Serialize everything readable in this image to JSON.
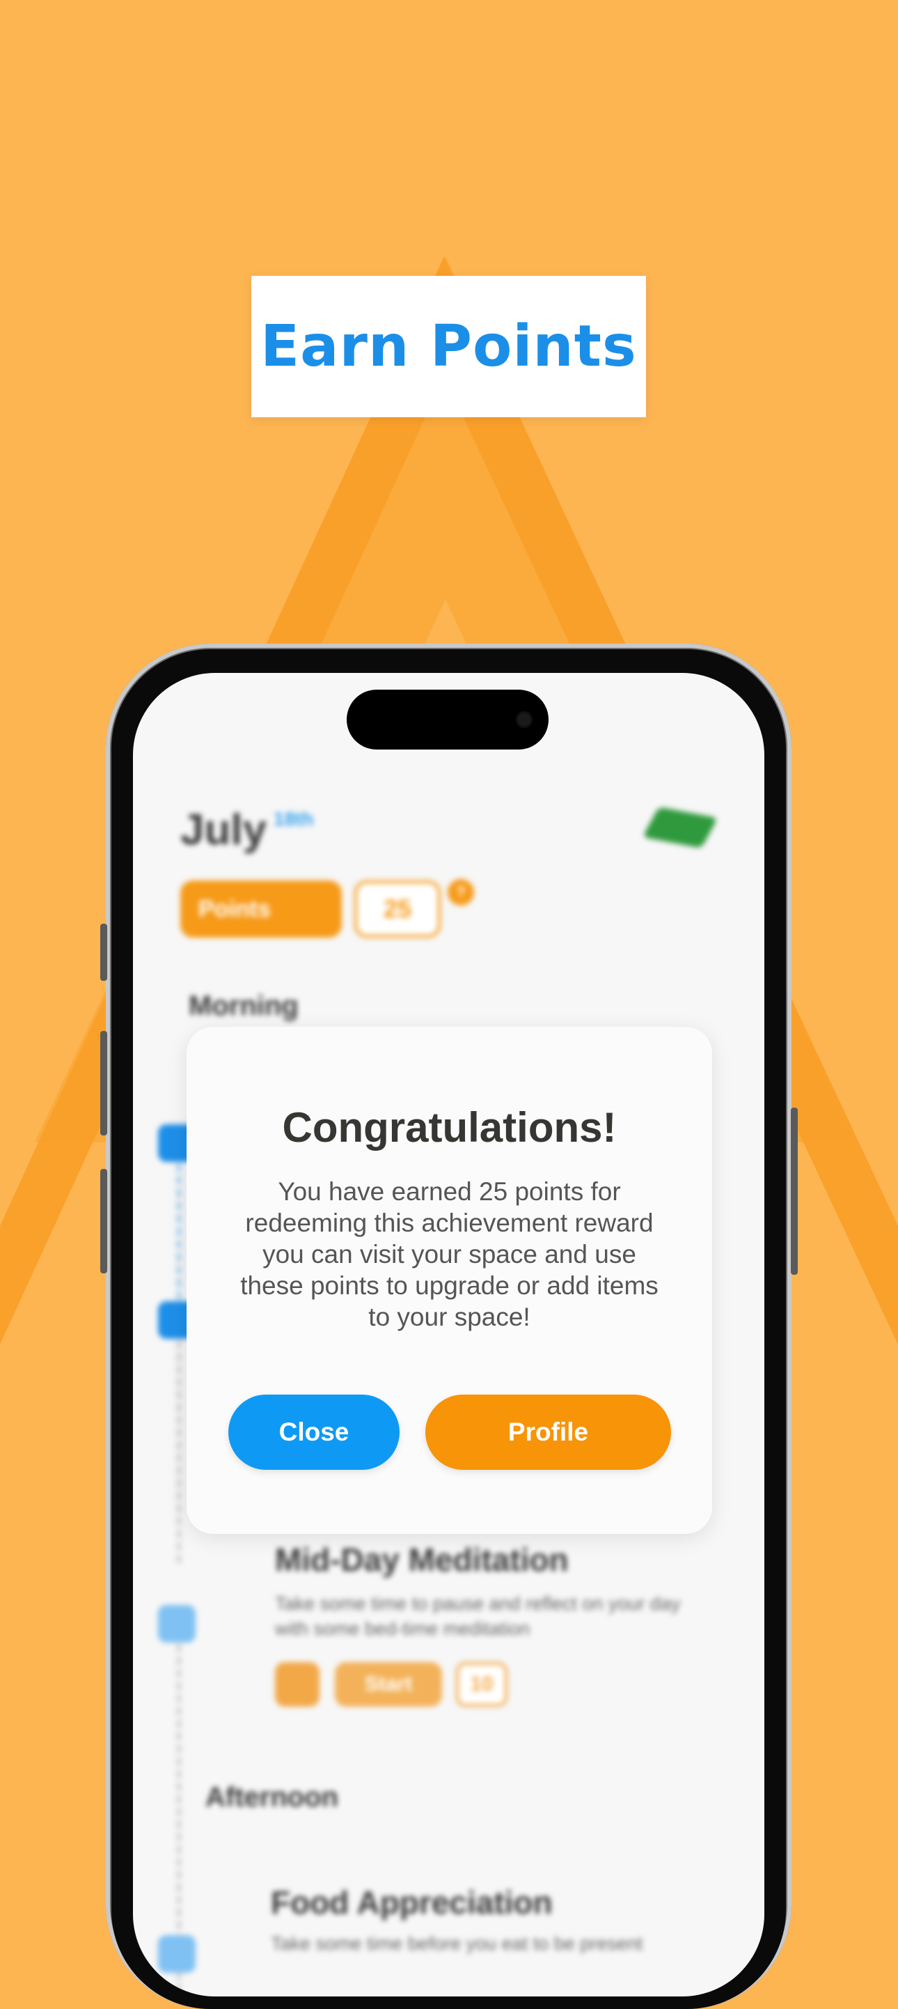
{
  "headline": "Earn Points",
  "app": {
    "month": "July",
    "day": "18th",
    "points_label": "Points",
    "points_value": "25",
    "badge": "?",
    "sections": {
      "morning": "Morning",
      "afternoon": "Afternoon"
    },
    "tasks": [
      {
        "title": "Mid-Day Meditation",
        "description": "Take some time to pause and reflect on your day with some bed-time meditation",
        "start_label": "Start",
        "points": "10"
      },
      {
        "title": "Food Appreciation",
        "description": "Take some time before you eat to be present"
      }
    ]
  },
  "modal": {
    "title": "Congratulations!",
    "body": "You have earned 25 points for redeeming this achievement reward you can visit your space and use these points to upgrade or add items to your space!",
    "close_label": "Close",
    "profile_label": "Profile"
  },
  "colors": {
    "background": "#FDB552",
    "triangle": "#F9A12A",
    "accent_blue": "#0E9AF4",
    "accent_orange": "#F89408"
  }
}
